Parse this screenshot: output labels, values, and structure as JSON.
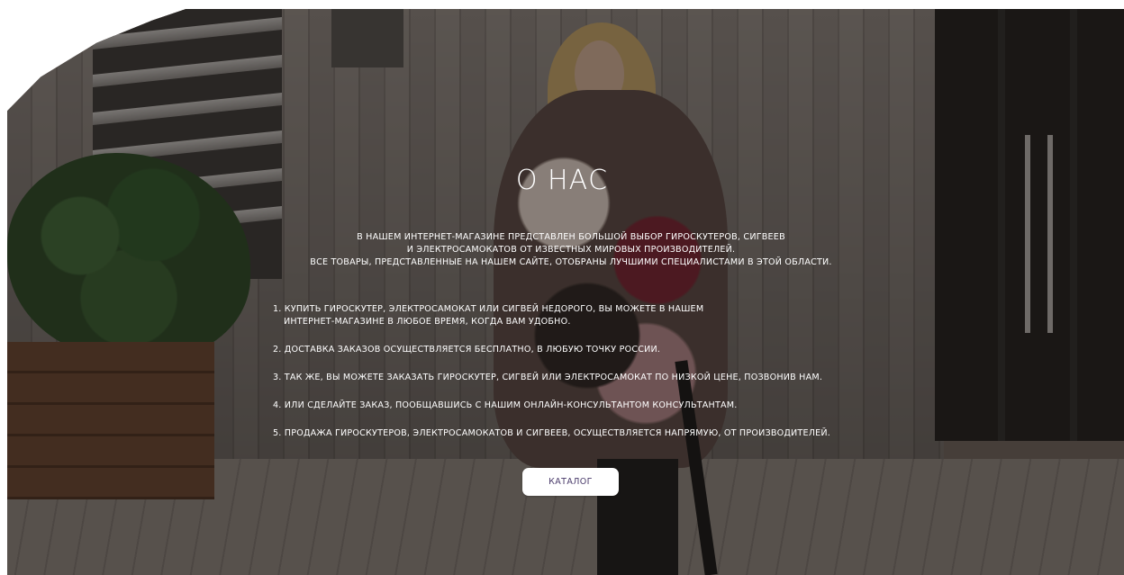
{
  "about": {
    "title": "О НАС",
    "intro_line1": "В НАШЕМ ИНТЕРНЕТ-МАГАЗИНЕ ПРЕДСТАВЛЕН БОЛЬШОЙ ВЫБОР ГИРОСКУТЕРОВ, СИГВЕЕВ",
    "intro_line2": "И ЭЛЕКТРОСАМОКАТОВ ОТ ИЗВЕСТНЫХ МИРОВЫХ ПРОИЗВОДИТЕЛЕЙ.",
    "intro_line3": "ВСЕ ТОВАРЫ, ПРЕДСТАВЛЕННЫЕ НА НАШЕМ САЙТЕ, ОТОБРАНЫ ЛУЧШИМИ СПЕЦИАЛИСТАМИ В ЭТОЙ ОБЛАСТИ.",
    "items": [
      {
        "line1": "1. КУПИТЬ ГИРОСКУТЕР, ЭЛЕКТРОСАМОКАТ ИЛИ СИГВЕЙ НЕДОРОГО, ВЫ МОЖЕТЕ В НАШЕМ",
        "line2": "ИНТЕРНЕТ-МАГАЗИНЕ В ЛЮБОЕ ВРЕМЯ, КОГДА ВАМ УДОБНО."
      },
      {
        "line1": "2. ДОСТАВКА ЗАКАЗОВ ОСУЩЕСТВЛЯЕТСЯ БЕСПЛАТНО, В ЛЮБУЮ ТОЧКУ РОССИИ.",
        "line2": ""
      },
      {
        "line1": "3. ТАК ЖЕ, ВЫ МОЖЕТЕ ЗАКАЗАТЬ ГИРОСКУТЕР, СИГВЕЙ ИЛИ ЭЛЕКТРОСАМОКАТ ПО НИЗКОЙ ЦЕНЕ, ПОЗВОНИВ НАМ.",
        "line2": ""
      },
      {
        "line1": "4. ИЛИ СДЕЛАЙТЕ ЗАКАЗ, ПООБЩАВШИСЬ С НАШИМ ОНЛАЙН-КОНСУЛЬТАНТОМ КОНСУЛЬТАНТАМ.",
        "line2": ""
      },
      {
        "line1": "5. ПРОДАЖА ГИРОСКУТЕРОВ, ЭЛЕКТРОСАМОКАТОВ И СИГВЕЕВ, ОСУЩЕСТВЛЯЕТСЯ НАПРЯМУЮ, ОТ ПРОИЗВОДИТЕЛЕЙ.",
        "line2": ""
      }
    ],
    "button_label": "КАТАЛОГ"
  },
  "colors": {
    "text": "#ffffff",
    "button_bg": "#ffffff",
    "button_text": "#4a3b6b"
  }
}
